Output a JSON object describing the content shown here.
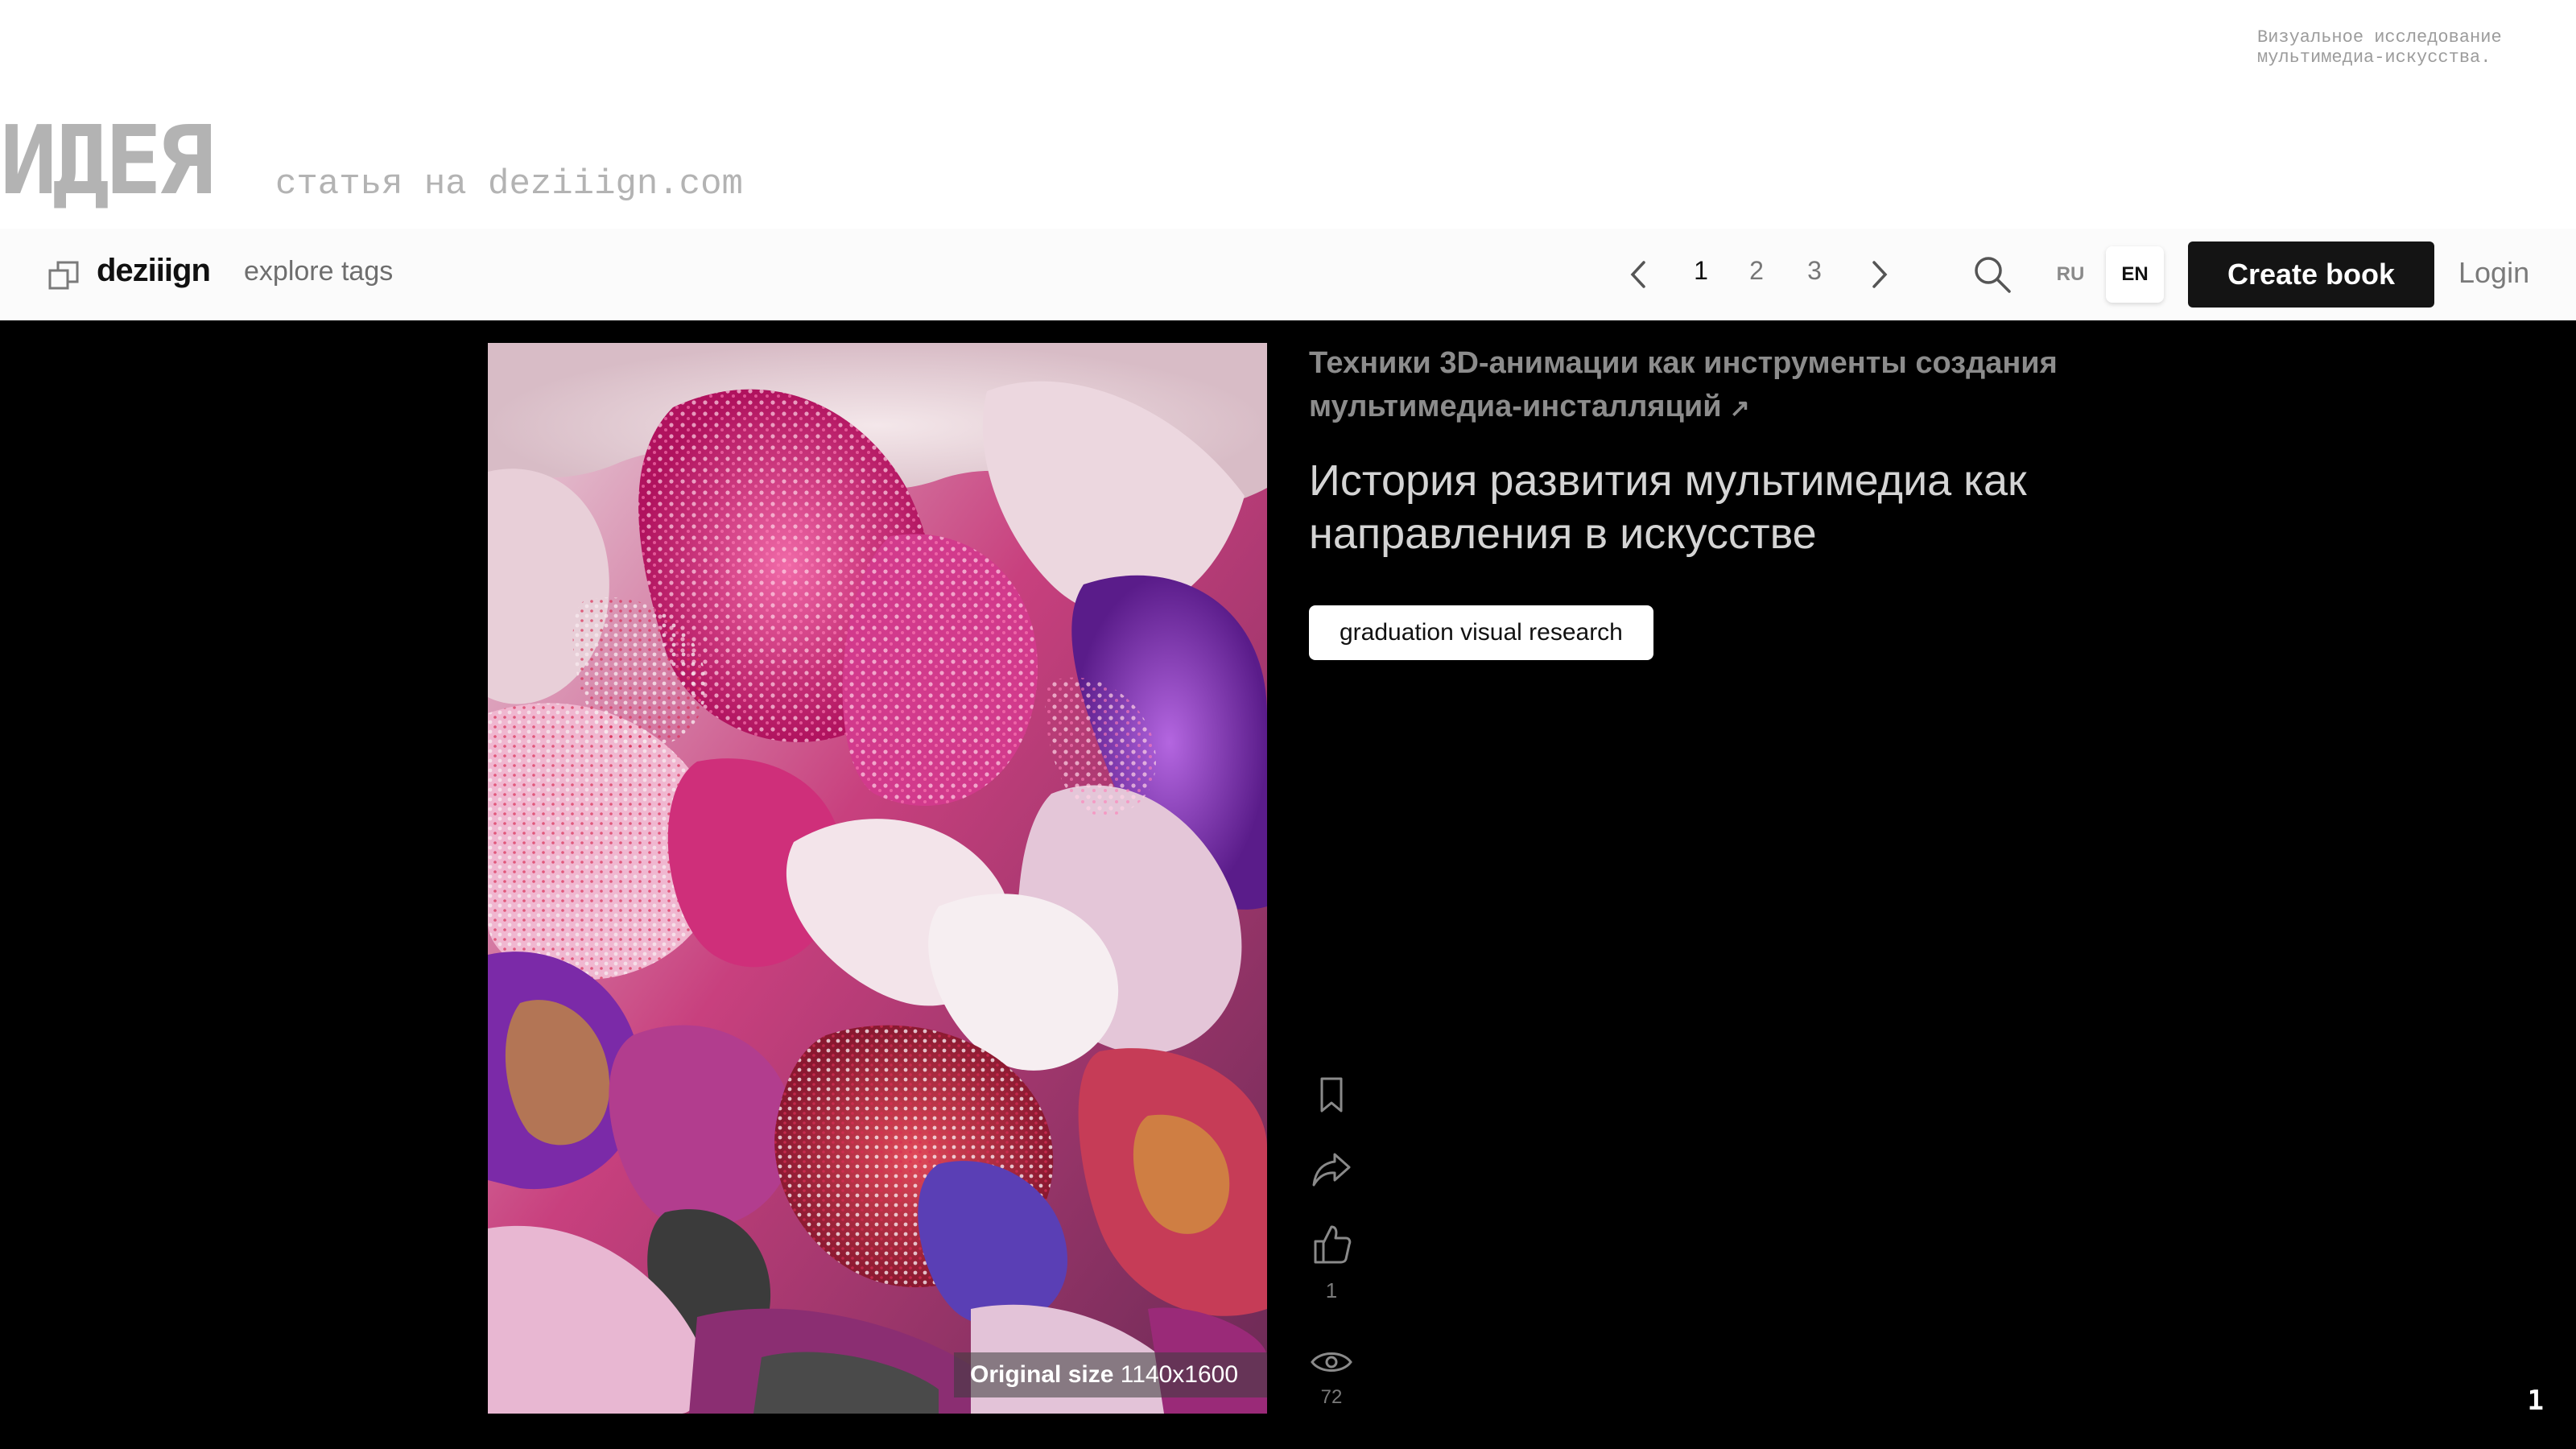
{
  "banner": {
    "big_title": "ИДЕЯ",
    "subtitle": "статья на deziiign.com",
    "corner_note": "Визуальное исследование мультимедиа-искусства."
  },
  "navbar": {
    "logo_icon": "stacked-squares-icon",
    "logo_text": "deziiign",
    "explore_label": "explore tags",
    "pagination": {
      "prev_icon": "chevron-left-icon",
      "next_icon": "chevron-right-icon",
      "pages": [
        "1",
        "2",
        "3"
      ],
      "current": "1"
    },
    "search_icon": "search-icon",
    "languages": [
      "RU",
      "EN"
    ],
    "active_language": "EN",
    "create_book_label": "Create book",
    "login_label": "Login"
  },
  "post": {
    "category": "Техники 3D-анимации как инструменты создания мультимедиа-инсталляций",
    "category_icon": "arrow-up-right-icon",
    "title": "История развития мультимедиа как направления в искусстве",
    "tag": "graduation visual research",
    "image": {
      "description_icon": "abstract-artwork-image",
      "original_size_label": "Original size",
      "original_size_value": "1140x1600"
    },
    "actions": {
      "bookmark_icon": "bookmark-icon",
      "share_icon": "share-icon",
      "like_icon": "thumbs-up-icon",
      "like_count": "1",
      "views_icon": "eye-icon",
      "view_count": "72"
    }
  },
  "page_indicator": "1",
  "colors": {
    "background_dark": "#000000",
    "button_dark": "#141414",
    "muted_text": "#8c8c8c",
    "title_text": "#d4d4d4",
    "art_magenta": "#c2186b",
    "art_pink": "#e8a6c8",
    "art_purple": "#8a2cc0"
  }
}
